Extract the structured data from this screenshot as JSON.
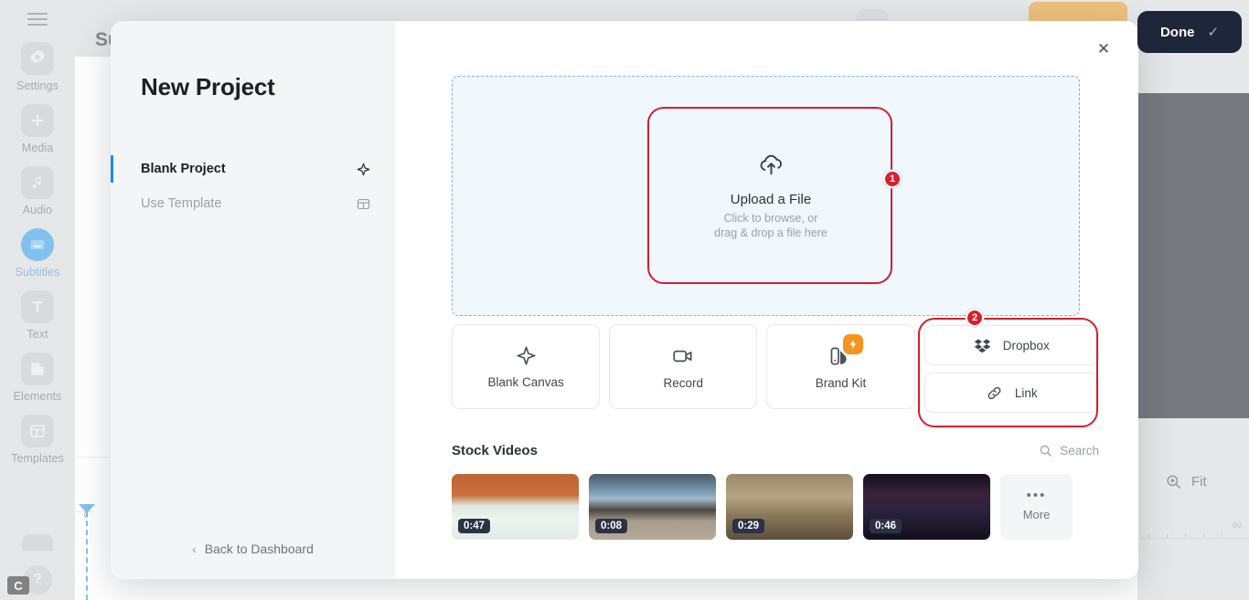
{
  "app": {
    "panel_title": "Su",
    "rail": {
      "menu_icon": "hamburger-icon",
      "items": [
        {
          "label": "Settings",
          "icon": "gear-icon",
          "active": false
        },
        {
          "label": "Media",
          "icon": "plus-square-icon",
          "active": false
        },
        {
          "label": "Audio",
          "icon": "music-note-icon",
          "active": false
        },
        {
          "label": "Subtitles",
          "icon": "subtitles-icon",
          "active": true
        },
        {
          "label": "Text",
          "icon": "text-t-icon",
          "active": false
        },
        {
          "label": "Elements",
          "icon": "elements-icon",
          "active": false
        },
        {
          "label": "Templates",
          "icon": "templates-icon",
          "active": false
        }
      ],
      "help_icon": "question-circle-icon",
      "brand_icon": "c-logo-icon"
    },
    "zoom": {
      "icon": "zoom-in-icon",
      "label": "Fit"
    },
    "ruler_label": "60",
    "playhead_label": "0",
    "done_button": {
      "label": "Done",
      "check_icon": "check-icon"
    }
  },
  "modal": {
    "title": "New Project",
    "close_icon": "close-icon",
    "nav": [
      {
        "label": "Blank Project",
        "icon": "sparkle-icon",
        "active": true
      },
      {
        "label": "Use Template",
        "icon": "layout-template-icon",
        "active": false
      }
    ],
    "back": {
      "label": "Back to Dashboard",
      "icon": "chevron-left-icon"
    },
    "dropzone": {
      "icon": "cloud-upload-icon",
      "title": "Upload a File",
      "subtitle_line1": "Click to browse, or",
      "subtitle_line2": "drag & drop a file here"
    },
    "annotations": [
      {
        "number": "1",
        "target": "upload-a-file-card"
      },
      {
        "number": "2",
        "target": "dropbox-and-link-buttons"
      }
    ],
    "cards": [
      {
        "label": "Blank Canvas",
        "icon": "sparkle-icon",
        "badge": null
      },
      {
        "label": "Record",
        "icon": "video-camera-icon",
        "badge": null
      },
      {
        "label": "Brand Kit",
        "icon": "brand-kit-palette-icon",
        "badge": "lightning-bolt-icon"
      }
    ],
    "side_buttons": [
      {
        "label": "Dropbox",
        "icon": "dropbox-icon"
      },
      {
        "label": "Link",
        "icon": "link-chain-icon"
      }
    ],
    "stock": {
      "title": "Stock Videos",
      "search_label": "Search",
      "search_icon": "search-icon",
      "videos": [
        {
          "duration": "0:47",
          "art": "t1"
        },
        {
          "duration": "0:08",
          "art": "t2"
        },
        {
          "duration": "0:29",
          "art": "t3"
        },
        {
          "duration": "0:46",
          "art": "t4"
        }
      ],
      "more": {
        "label": "More",
        "icon": "ellipsis-icon"
      }
    }
  },
  "colors": {
    "accent_blue": "#1a8fe3",
    "annotation_red": "#d8202d",
    "brand_orange": "#f79420",
    "done_navy": "#1e2639",
    "dropzone_fill": "#f0f7fd"
  }
}
